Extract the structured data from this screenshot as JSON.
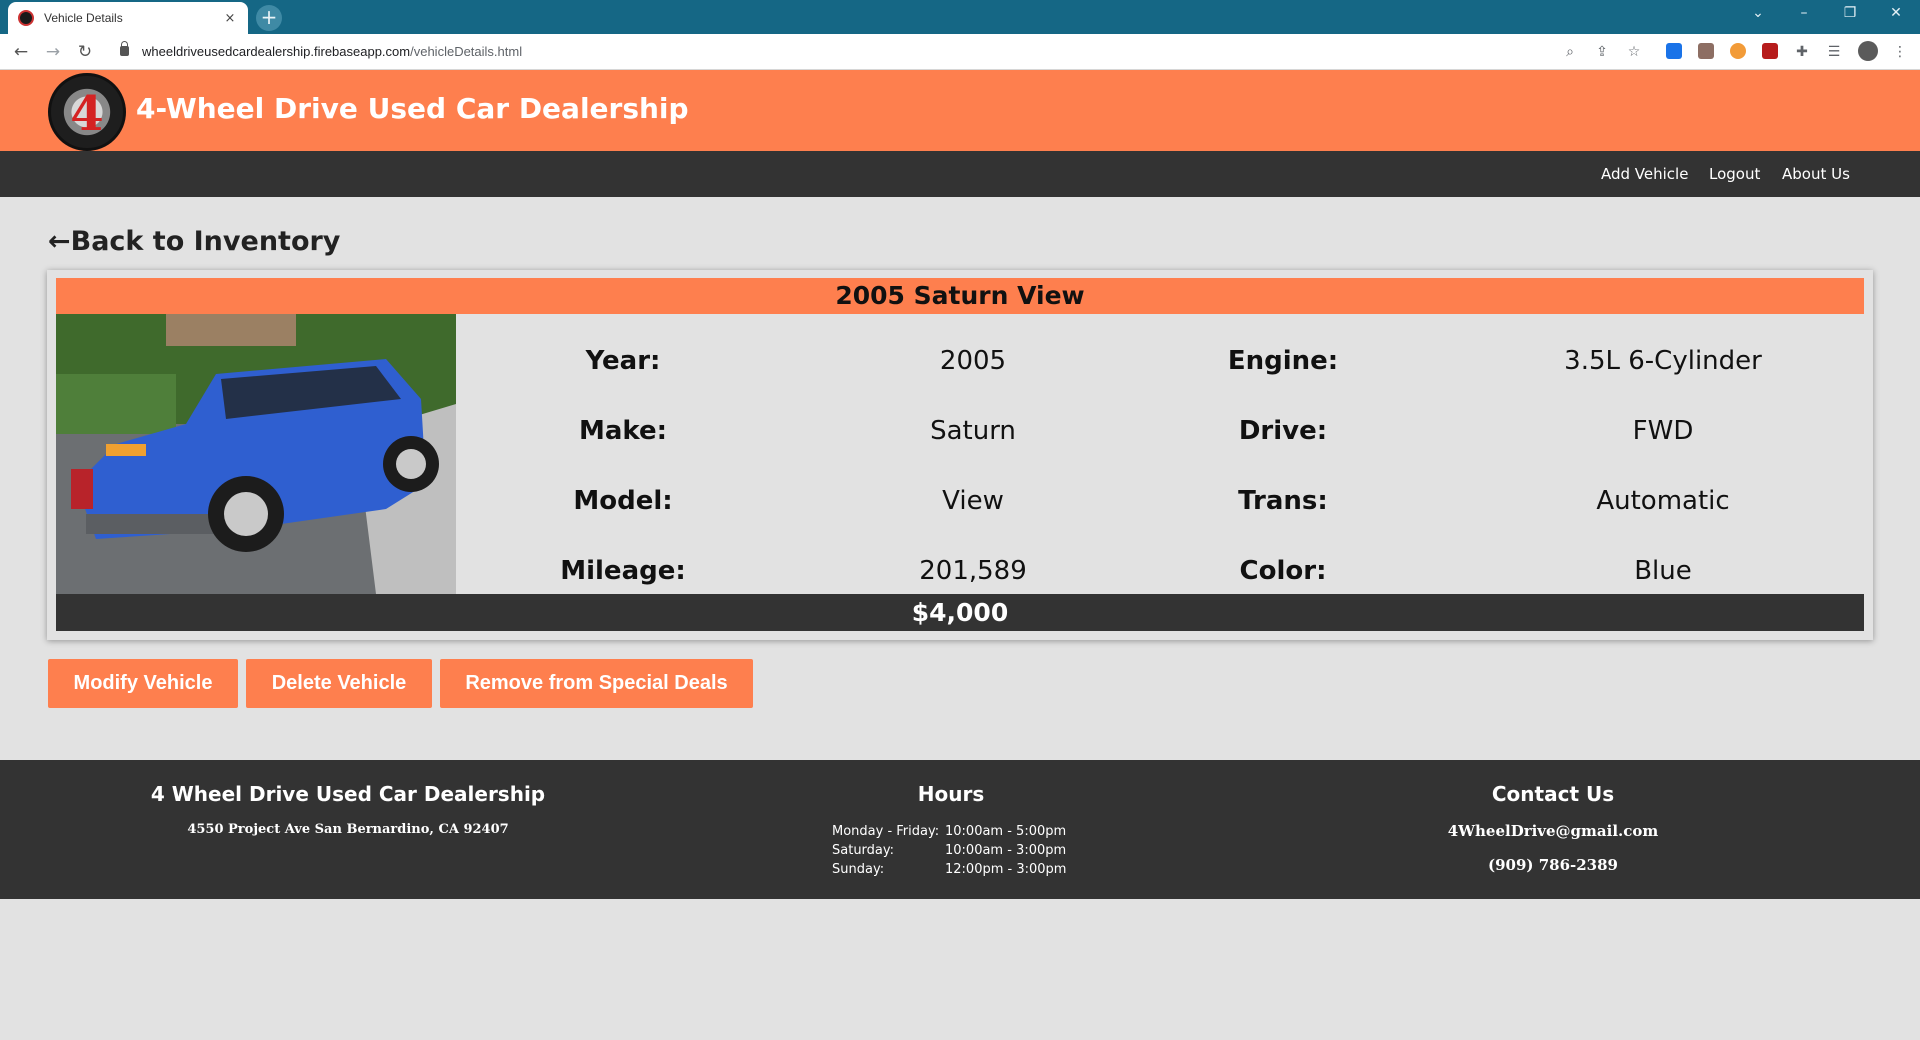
{
  "browser": {
    "tab_title": "Vehicle Details",
    "tab_close": "×",
    "new_tab": "+",
    "url_domain": "wheeldriveusedcardealership.firebaseapp.com",
    "url_path": "/vehicleDetails.html",
    "icons": [
      "back-icon",
      "forward-icon",
      "reload-icon",
      "lock-icon",
      "zoom-icon",
      "share-icon",
      "star-icon",
      "extensions-icon",
      "profile-icon",
      "menu-icon"
    ]
  },
  "header": {
    "logo_text": "4",
    "title": "4-Wheel Drive Used Car Dealership"
  },
  "nav": {
    "add_vehicle": "Add Vehicle",
    "logout": "Logout",
    "about": "About Us"
  },
  "back_link": "←Back to Inventory",
  "vehicle": {
    "title": "2005 Saturn View",
    "price": "$4,000",
    "specs": [
      {
        "label": "Year:",
        "value": "2005"
      },
      {
        "label": "Make:",
        "value": "Saturn"
      },
      {
        "label": "Model:",
        "value": "View"
      },
      {
        "label": "Mileage:",
        "value": "201,589"
      },
      {
        "label": "Engine:",
        "value": "3.5L 6-Cylinder"
      },
      {
        "label": "Drive:",
        "value": "FWD"
      },
      {
        "label": "Trans:",
        "value": "Automatic"
      },
      {
        "label": "Color:",
        "value": "Blue"
      }
    ]
  },
  "actions": {
    "modify": "Modify Vehicle",
    "delete": "Delete Vehicle",
    "remove_special": "Remove from Special Deals"
  },
  "footer": {
    "company": "4 Wheel Drive Used Car Dealership",
    "address": "4550 Project Ave San Bernardino, CA 92407",
    "hours_title": "Hours",
    "hours": [
      {
        "day": "Monday - Friday:",
        "time": "10:00am - 5:00pm"
      },
      {
        "day": "Saturday:",
        "time": "10:00am - 3:00pm"
      },
      {
        "day": "Sunday:",
        "time": "12:00pm - 3:00pm"
      }
    ],
    "contact_title": "Contact Us",
    "email": "4WheelDrive@gmail.com",
    "phone": "(909) 786-2389"
  },
  "colors": {
    "accent": "#fe7f4e",
    "dark": "#333333",
    "background": "#e2e2e2",
    "browser_frame": "#156785",
    "car_body": "#2f5fd0"
  }
}
